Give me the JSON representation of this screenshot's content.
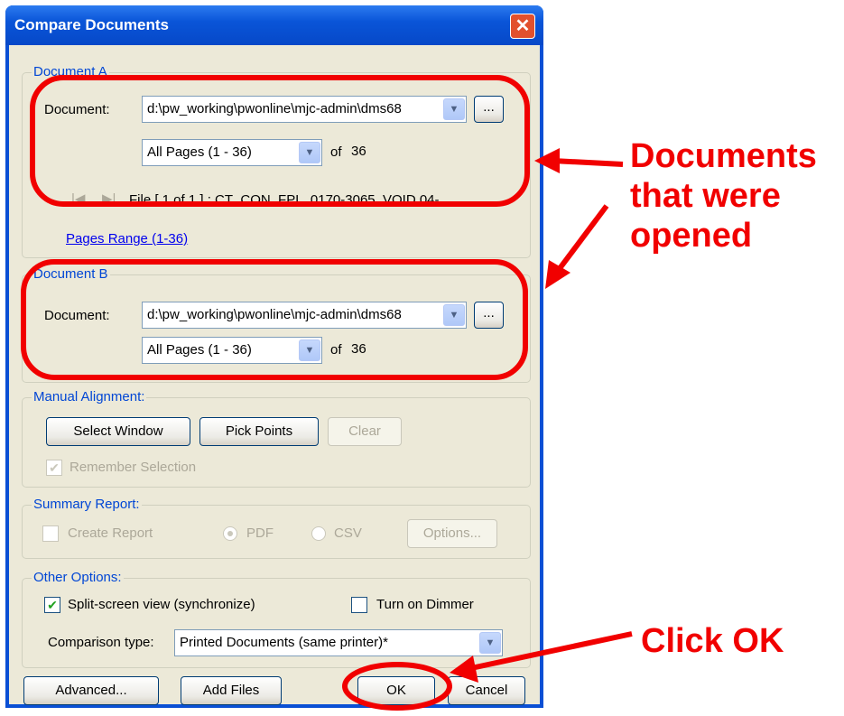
{
  "window": {
    "title": "Compare Documents",
    "close_icon": "close-icon"
  },
  "doc_a": {
    "legend": "Document A",
    "document_label": "Document:",
    "document_value": "d:\\pw_working\\pwonline\\mjc-admin\\dms68",
    "browse_label": "...",
    "pages_value": "All Pages (1 - 36)",
    "of_text": "of",
    "page_count": "36",
    "file_info": "File [ 1 of 1 ] :  CT_CON_FPL_0170-3065_VOID 04-...",
    "pages_range_link": "Pages Range (1-36)"
  },
  "doc_b": {
    "legend": "Document B",
    "document_label": "Document:",
    "document_value": "d:\\pw_working\\pwonline\\mjc-admin\\dms68",
    "browse_label": "...",
    "pages_value": "All Pages (1 - 36)",
    "of_text": "of",
    "page_count": "36"
  },
  "manual_alignment": {
    "legend": "Manual Alignment:",
    "select_window": "Select Window",
    "pick_points": "Pick Points",
    "clear": "Clear",
    "remember_selection": "Remember Selection",
    "remember_checked": true
  },
  "summary_report": {
    "legend": "Summary Report:",
    "create_report": "Create Report",
    "pdf": "PDF",
    "csv": "CSV",
    "options": "Options..."
  },
  "other_options": {
    "legend": "Other Options:",
    "split_screen": "Split-screen view (synchronize)",
    "split_screen_checked": true,
    "dimmer": "Turn on Dimmer",
    "dimmer_checked": false,
    "comparison_label": "Comparison type:",
    "comparison_value": "Printed Documents (same printer)*"
  },
  "footer": {
    "advanced": "Advanced...",
    "add_files": "Add Files",
    "ok": "OK",
    "cancel": "Cancel"
  },
  "annotations": {
    "documents_line1": "Documents",
    "documents_line2": "that were",
    "documents_line3": "opened",
    "click_ok": "Click OK",
    "color": "#f10000"
  }
}
